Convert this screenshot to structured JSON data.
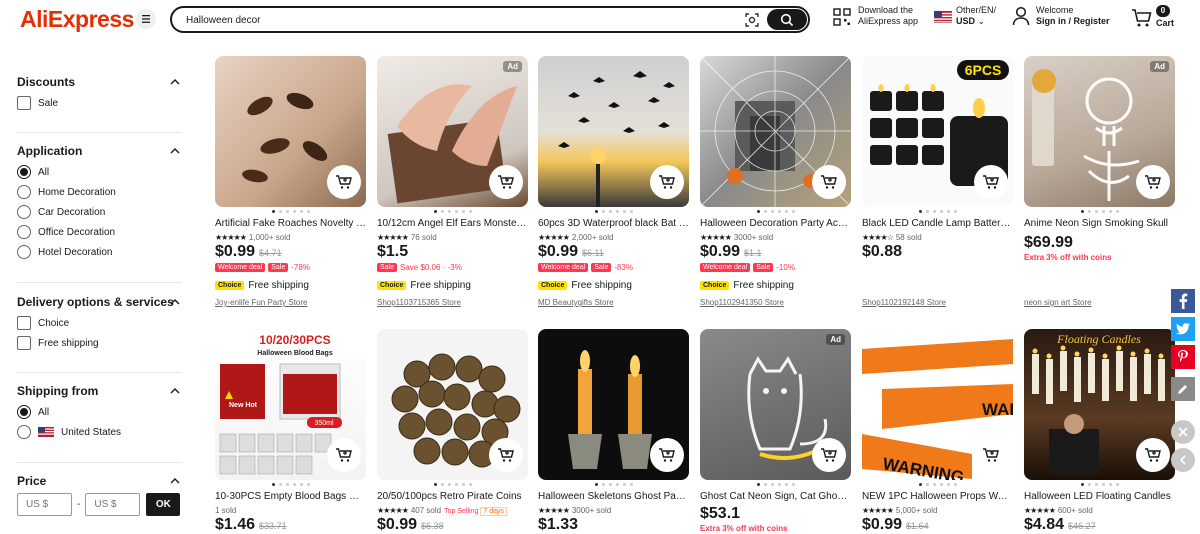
{
  "header": {
    "logo": "AliExpress",
    "search_value": "Halloween decor",
    "app_line1": "Download the",
    "app_line2": "AliExpress app",
    "locale_line1": "Other/EN/",
    "locale_line2": "USD",
    "account_line1": "Welcome",
    "account_line2": "Sign in / Register",
    "cart_count": "0",
    "cart_label": "Cart"
  },
  "sidebar": {
    "discounts": {
      "title": "Discounts",
      "options": [
        "Sale"
      ]
    },
    "application": {
      "title": "Application",
      "options": [
        "All",
        "Home Decoration",
        "Car Decoration",
        "Office Decoration",
        "Hotel Decoration"
      ],
      "selected": "All"
    },
    "delivery": {
      "title": "Delivery options & services",
      "options": [
        "Choice",
        "Free shipping"
      ]
    },
    "shipping_from": {
      "title": "Shipping from",
      "options": [
        "All",
        "United States"
      ],
      "selected": "All"
    },
    "price": {
      "title": "Price",
      "min_placeholder": "US $",
      "max_placeholder": "US $",
      "dash": "-",
      "ok": "OK"
    }
  },
  "products": [
    {
      "title": "Artificial Fake Roaches Novelty Toys",
      "rating": "1,000+ sold",
      "price": "$0.99",
      "orig": "$4.71",
      "badges": [
        "Welcome deal",
        "Sale"
      ],
      "discount": "-78%",
      "choice": "Choice",
      "ship": "Free shipping",
      "store": "Joy-enlife Fun Party Store",
      "ad": false
    },
    {
      "title": "10/12cm Angel Elf Ears Monster Ears",
      "rating": "76 sold",
      "price": "$1.5",
      "orig": "",
      "badges": [
        "Sale"
      ],
      "discount": "Save $0.06 · -3%",
      "choice": "Choice",
      "ship": "Free shipping",
      "store": "Shop1103715365 Store",
      "ad": true
    },
    {
      "title": "60pcs 3D Waterproof black Bat Stickers",
      "rating": "2,000+ sold",
      "price": "$0.99",
      "orig": "$6.11",
      "badges": [
        "Welcome deal",
        "Sale"
      ],
      "discount": "-83%",
      "choice": "Choice",
      "ship": "Free shipping",
      "store": "MD Beautygifts Store",
      "ad": false
    },
    {
      "title": "Halloween Decoration Party Accessories",
      "rating": "3000+ sold",
      "price": "$0.99",
      "orig": "$1.1",
      "badges": [
        "Welcome deal",
        "Sale"
      ],
      "discount": "-10%",
      "choice": "Choice",
      "ship": "Free shipping",
      "store": "Shop1102941350 Store",
      "ad": false
    },
    {
      "title": "Black LED Candle Lamp Battery Powered",
      "rating": "58 sold",
      "price": "$0.88",
      "orig": "",
      "badges": [],
      "discount": "",
      "choice": "",
      "ship": "",
      "store": "Shop1102192148 Store",
      "ad": false
    },
    {
      "title": "Anime Neon Sign Smoking Skull",
      "rating": "",
      "price": "$69.99",
      "orig": "",
      "badges": [],
      "discount": "",
      "extra": "Extra 3% off with coins",
      "choice": "",
      "ship": "",
      "store": "neon sign art Store",
      "ad": true
    },
    {
      "title": "10-30PCS Empty Blood Bags Halloween",
      "rating": "1 sold",
      "price": "$1.46",
      "orig": "$33.71",
      "ad": false
    },
    {
      "title": "20/50/100pcs Retro Pirate Coins",
      "rating": "407 sold",
      "price": "$0.99",
      "orig": "$6.38",
      "topsell": "Top Selling",
      "days": "7 days",
      "ad": false
    },
    {
      "title": "Halloween Skeletons Ghost Party Candle",
      "rating": "3000+ sold",
      "price": "$1.33",
      "orig": "",
      "ad": false
    },
    {
      "title": "Ghost Cat Neon Sign, Cat Ghost Light",
      "rating": "",
      "price": "$53.1",
      "orig": "",
      "extra": "Extra 3% off with coins",
      "ad": true
    },
    {
      "title": "NEW 1PC Halloween Props Warning Tape",
      "rating": "5,000+ sold",
      "price": "$0.99",
      "orig": "$1.64",
      "ad": false
    },
    {
      "title": "Halloween LED Floating Candles",
      "rating": "600+ sold",
      "price": "$4.84",
      "orig": "$46.27",
      "ad": false
    }
  ],
  "ad_label": "Ad",
  "colors": {
    "accent": "#fd384f",
    "choice": "#ffe200",
    "brand": "#e62e04",
    "text": "#191919"
  },
  "img_text": {
    "sixpcs": "6PCS",
    "blood_title": "10/20/30PCS",
    "blood_sub": "Halloween Blood Bags",
    "blood_ml": "350ml",
    "blood_newhot": "New Hot",
    "warn": "WARNING",
    "floating": "Floating Candles"
  }
}
